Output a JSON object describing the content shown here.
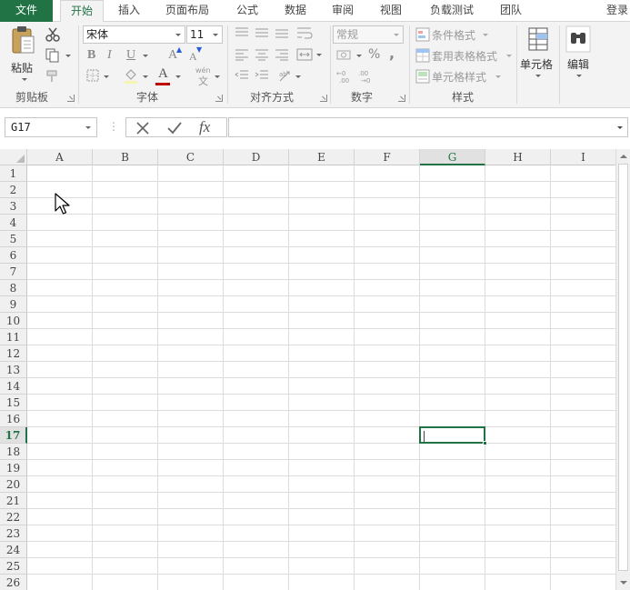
{
  "tabs": [
    {
      "label": "文件",
      "kind": "file"
    },
    {
      "label": "开始",
      "kind": "active"
    },
    {
      "label": "插入"
    },
    {
      "label": "页面布局"
    },
    {
      "label": "公式"
    },
    {
      "label": "数据"
    },
    {
      "label": "审阅"
    },
    {
      "label": "视图"
    },
    {
      "label": "负载测试"
    },
    {
      "label": "团队"
    }
  ],
  "login_label": "登录",
  "ribbon": {
    "clipboard": {
      "label": "剪贴板",
      "paste_label": "粘贴"
    },
    "font": {
      "label": "字体",
      "font_name": "宋体",
      "font_size": "11",
      "bold": "B",
      "italic": "I",
      "underline": "U",
      "grow": "A",
      "shrink": "A",
      "font_color_letter": "A",
      "wen": "wén",
      "wen_char": "文"
    },
    "alignment": {
      "label": "对齐方式"
    },
    "number": {
      "label": "数字",
      "format": "常规",
      "percent": "%",
      "comma": ","
    },
    "styles": {
      "label": "样式",
      "conditional": "条件格式",
      "table_format": "套用表格格式",
      "cell_styles": "单元格样式"
    },
    "cells": {
      "label": "单元格"
    },
    "editing": {
      "label": "编辑"
    }
  },
  "formula_bar": {
    "name_box": "G17",
    "fx": "fx",
    "value": ""
  },
  "columns": [
    "A",
    "B",
    "C",
    "D",
    "E",
    "F",
    "G",
    "H",
    "I"
  ],
  "rows": [
    "1",
    "2",
    "3",
    "4",
    "5",
    "6",
    "7",
    "8",
    "9",
    "10",
    "11",
    "12",
    "13",
    "14",
    "15",
    "16",
    "17",
    "18",
    "19",
    "20",
    "21",
    "22",
    "23",
    "24",
    "25",
    "26"
  ],
  "active_cell": {
    "column": "G",
    "row": "17"
  },
  "colors": {
    "accent": "#217346",
    "gridline": "#dcdcdc",
    "header_bg": "#f0f0f0",
    "font_red": "#c00000"
  }
}
